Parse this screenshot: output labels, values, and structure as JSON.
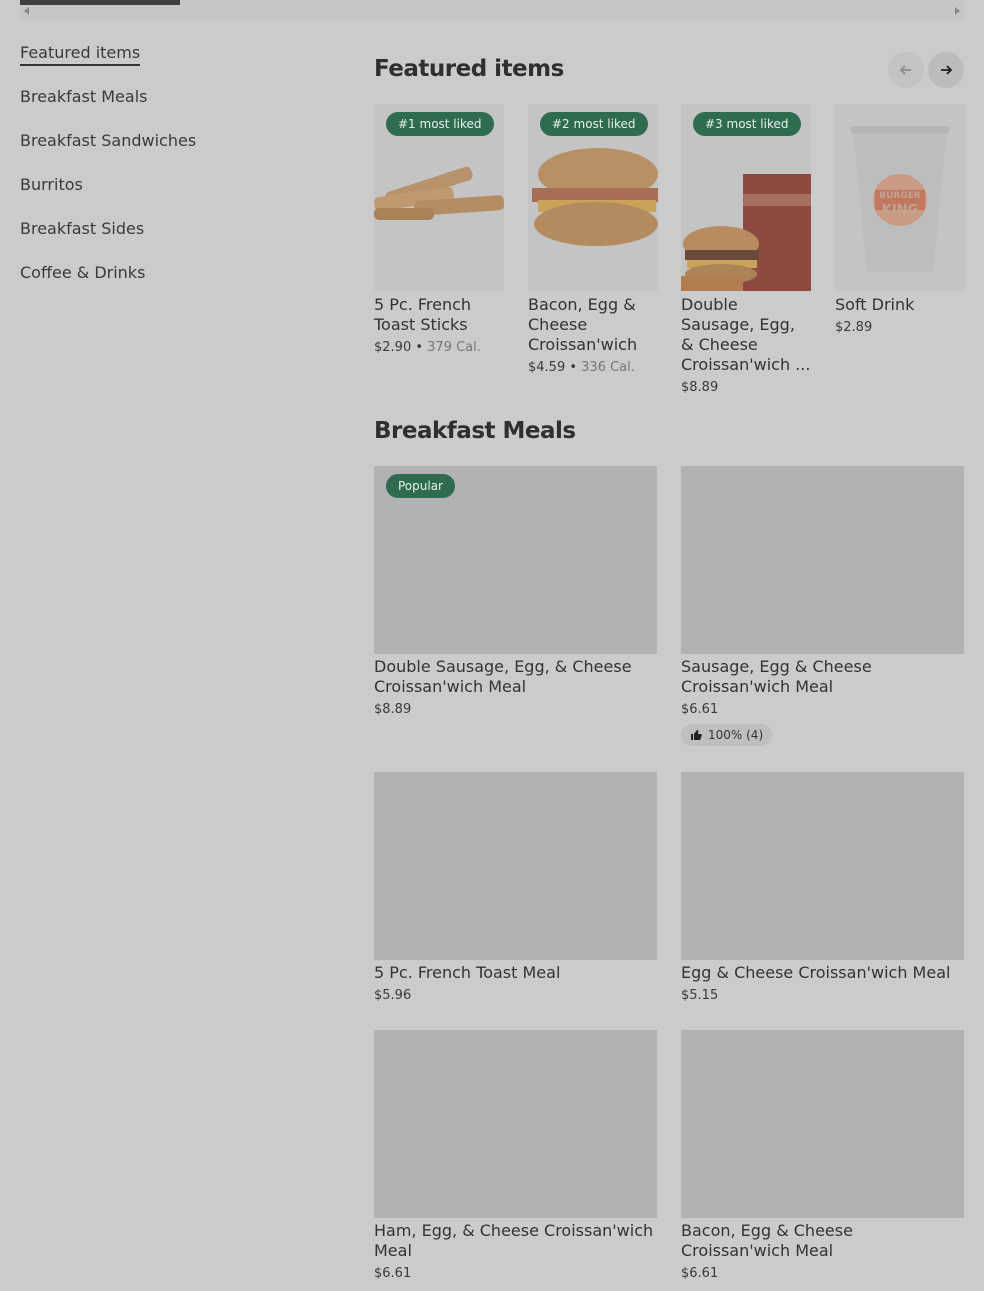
{
  "nav": {
    "items": [
      {
        "label": "Featured items",
        "active": true
      },
      {
        "label": "Breakfast Meals"
      },
      {
        "label": "Breakfast Sandwiches"
      },
      {
        "label": "Burritos"
      },
      {
        "label": "Breakfast Sides"
      },
      {
        "label": "Coffee & Drinks"
      }
    ]
  },
  "featured": {
    "title": "Featured items",
    "prev_icon": "arrow-left-icon",
    "next_icon": "arrow-right-icon",
    "items": [
      {
        "badge": "#1 most liked",
        "name": "5 Pc. French Toast Sticks",
        "price": "$2.90",
        "sep": " • ",
        "calories": "379 Cal."
      },
      {
        "badge": "#2 most liked",
        "name": "Bacon, Egg & Cheese Croissan'wich",
        "price": "$4.59",
        "sep": " • ",
        "calories": "336 Cal."
      },
      {
        "badge": "#3 most liked",
        "name": "Double Sausage, Egg, & Cheese Croissan'wich ...",
        "price": "$8.89"
      },
      {
        "name": "Soft Drink",
        "price": "$2.89",
        "logo_text_1": "BURGER",
        "logo_text_2": "KING"
      }
    ]
  },
  "breakfast_meals": {
    "title": "Breakfast Meals",
    "items": [
      {
        "badge": "Popular",
        "name": "Double Sausage, Egg, & Cheese Croissan'wich Meal",
        "price": "$8.89"
      },
      {
        "name": "Sausage, Egg & Cheese Croissan'wich Meal",
        "price": "$6.61",
        "rating": "100% (4)"
      },
      {
        "name": "5 Pc. French Toast Meal",
        "price": "$5.96"
      },
      {
        "name": "Egg & Cheese Croissan'wich Meal",
        "price": "$5.15"
      },
      {
        "name": "Ham, Egg, & Cheese Croissan'wich Meal",
        "price": "$6.61"
      },
      {
        "name": "Bacon, Egg & Cheese Croissan'wich Meal",
        "price": "$6.61"
      }
    ]
  },
  "colors": {
    "badge_bg": "#2e6b4f",
    "overlay": "#cbcbcb"
  }
}
